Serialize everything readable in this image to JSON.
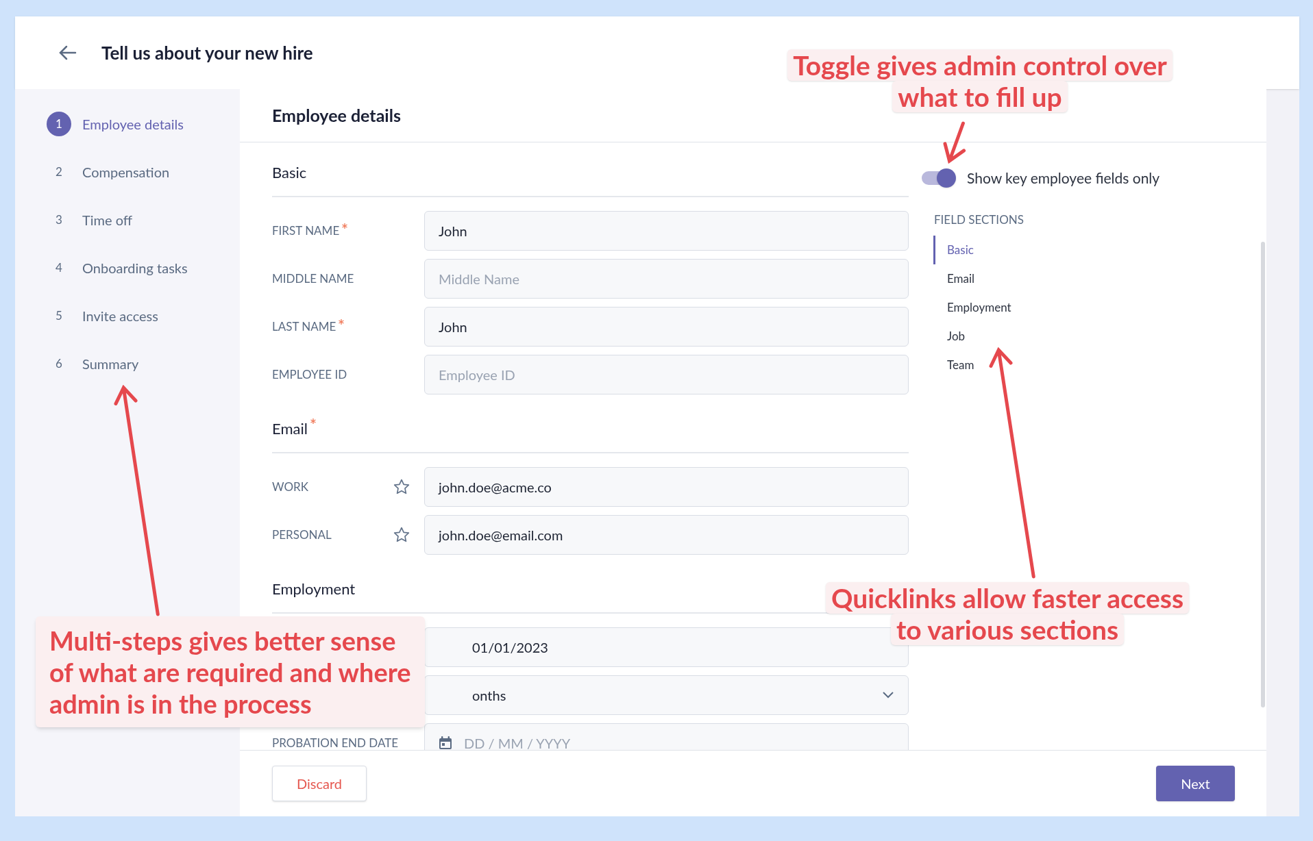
{
  "header": {
    "title": "Tell us about your new hire"
  },
  "steps": [
    {
      "number": "1",
      "label": "Employee details",
      "selected": true
    },
    {
      "number": "2",
      "label": "Compensation",
      "selected": false
    },
    {
      "number": "3",
      "label": "Time off",
      "selected": false
    },
    {
      "number": "4",
      "label": "Onboarding tasks",
      "selected": false
    },
    {
      "number": "5",
      "label": "Invite access",
      "selected": false
    },
    {
      "number": "6",
      "label": "Summary",
      "selected": false
    }
  ],
  "panel": {
    "title": "Employee details"
  },
  "sections": [
    {
      "title": "Basic",
      "required": false,
      "fields": [
        {
          "kind": "text",
          "label": "FIRST NAME",
          "required": true,
          "value": "John"
        },
        {
          "kind": "text",
          "label": "MIDDLE NAME",
          "required": false,
          "placeholder": "Middle Name"
        },
        {
          "kind": "text",
          "label": "LAST NAME",
          "required": true,
          "value": "John"
        },
        {
          "kind": "text",
          "label": "EMPLOYEE ID",
          "required": false,
          "placeholder": "Employee ID"
        }
      ]
    },
    {
      "title": "Email",
      "required": true,
      "fields": [
        {
          "kind": "email",
          "label": "WORK",
          "required": false,
          "value": "john.doe@acme.co"
        },
        {
          "kind": "email",
          "label": "PERSONAL",
          "required": false,
          "value": "john.doe@email.com"
        }
      ]
    },
    {
      "title": "Employment",
      "required": false,
      "fields": [
        {
          "kind": "text",
          "value": "01/01/2023"
        },
        {
          "kind": "select",
          "value": "onths"
        },
        {
          "kind": "date",
          "label": "PROBATION END DATE",
          "required": false,
          "placeholder": "DD / MM / YYYY"
        }
      ]
    }
  ],
  "toggle": {
    "label": "Show key employee fields only",
    "on": true
  },
  "quicklinks": {
    "title": "FIELD SECTIONS",
    "items": [
      {
        "label": "Basic",
        "selected": true
      },
      {
        "label": "Email",
        "selected": false
      },
      {
        "label": "Employment",
        "selected": false
      },
      {
        "label": "Job",
        "selected": false
      },
      {
        "label": "Team",
        "selected": false
      }
    ]
  },
  "footer": {
    "discard": "Discard",
    "next": "Next"
  },
  "annotations": [
    {
      "kind": "top",
      "lines": [
        "Toggle gives admin control over",
        "what to fill up"
      ]
    },
    {
      "kind": "left",
      "lines": [
        "Multi-steps gives better sense",
        "of what are required and where",
        "admin is in the process"
      ]
    },
    {
      "kind": "right",
      "lines": [
        "Quicklinks allow faster access",
        "to various sections"
      ]
    }
  ]
}
